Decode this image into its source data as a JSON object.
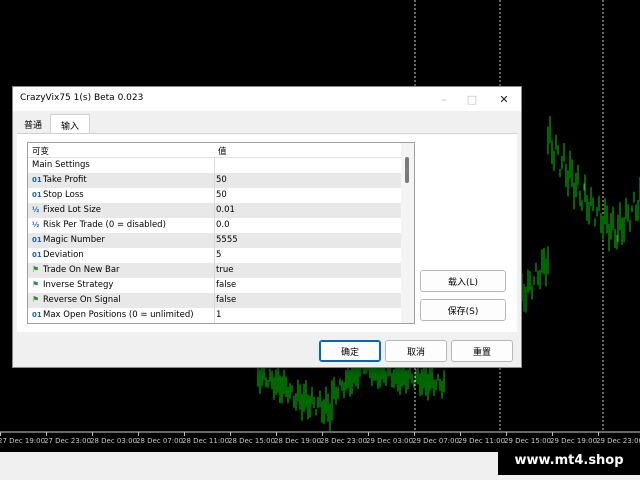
{
  "chart": {
    "candle_color": "#00cc00",
    "x_labels": [
      "27 Dec 19:00",
      "27 Dec 23:00",
      "28 Dec 03:00",
      "28 Dec 07:00",
      "28 Dec 11:00",
      "28 Dec 15:00",
      "28 Dec 19:00",
      "28 Dec 23:00",
      "29 Dec 03:00",
      "29 Dec 07:00",
      "29 Dec 11:00",
      "29 Dec 15:00",
      "29 Dec 19:00",
      "29 Dec 23:00"
    ]
  },
  "watermark": "www.mt4.shop",
  "dialog": {
    "title": "CrazyVix75 1(s) Beta 0.023",
    "minimize": "–",
    "maximize": "□",
    "close": "✕",
    "tabs": [
      {
        "label": "普通",
        "active": false
      },
      {
        "label": "输入",
        "active": true
      }
    ],
    "grid": {
      "col_variable": "可变",
      "col_value": "值",
      "rows": [
        {
          "icon": "",
          "name": "Main Settings",
          "value": ""
        },
        {
          "icon": "01",
          "name": "Take Profit",
          "value": "50"
        },
        {
          "icon": "01",
          "name": "Stop Loss",
          "value": "50"
        },
        {
          "icon": "½",
          "name": "Fixed Lot Size",
          "value": "0.01"
        },
        {
          "icon": "½",
          "name": "Risk Per Trade (0 = disabled)",
          "value": "0.0"
        },
        {
          "icon": "01",
          "name": "Magic Number",
          "value": "5555"
        },
        {
          "icon": "01",
          "name": "Deviation",
          "value": "5"
        },
        {
          "icon": "⚑",
          "name": "Trade On New Bar",
          "value": "true"
        },
        {
          "icon": "⚑",
          "name": "Inverse Strategy",
          "value": "false"
        },
        {
          "icon": "⚑",
          "name": "Reverse On Signal",
          "value": "false"
        },
        {
          "icon": "01",
          "name": "Max Open Positions (0 = unlimited)",
          "value": "1"
        }
      ]
    },
    "buttons": {
      "load": "载入(L)",
      "save": "保存(S)",
      "ok": "确定",
      "cancel": "取消",
      "reset": "重置"
    }
  }
}
